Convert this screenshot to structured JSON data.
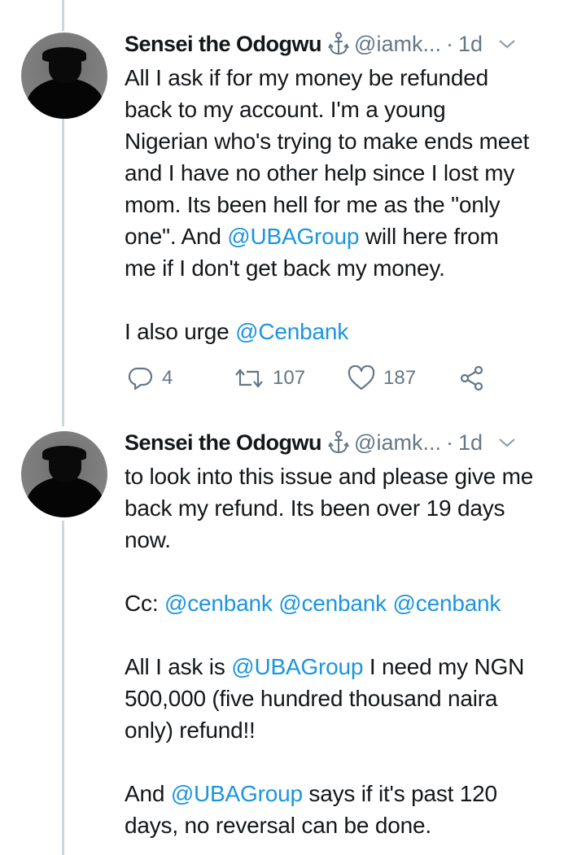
{
  "tweets": [
    {
      "author": "Sensei the Odogwu",
      "handle": "@iamk...",
      "separator": "·",
      "time": "1d",
      "lines": [
        [
          {
            "t": "All I ask if for my money be refunded"
          }
        ],
        [
          {
            "t": "back to my account. I'm a young"
          }
        ],
        [
          {
            "t": "Nigerian who's trying to make ends meet"
          }
        ],
        [
          {
            "t": "and I have no other help since I lost my"
          }
        ],
        [
          {
            "t": "mom. Its been hell for me as the \"only"
          }
        ],
        [
          {
            "t": "one\". And  "
          },
          {
            "t": "@UBAGroup",
            "m": true
          },
          {
            "t": " will here from"
          }
        ],
        [
          {
            "t": "me if I don't get back my money."
          }
        ],
        [],
        [
          {
            "t": "I also urge "
          },
          {
            "t": "@Cenbank",
            "m": true
          }
        ]
      ],
      "stats": {
        "replies": "4",
        "retweets": "107",
        "likes": "187"
      }
    },
    {
      "author": "Sensei the Odogwu",
      "handle": "@iamk...",
      "separator": "·",
      "time": "1d",
      "lines": [
        [
          {
            "t": "to look into this issue and please give me"
          }
        ],
        [
          {
            "t": "back my refund. Its been over 19 days"
          }
        ],
        [
          {
            "t": "now."
          }
        ],
        [],
        [
          {
            "t": "Cc: "
          },
          {
            "t": "@cenbank",
            "m": true
          },
          {
            "t": " "
          },
          {
            "t": "@cenbank",
            "m": true
          },
          {
            "t": " "
          },
          {
            "t": "@cenbank",
            "m": true
          }
        ],
        [],
        [
          {
            "t": "All I ask is "
          },
          {
            "t": "@UBAGroup",
            "m": true
          },
          {
            "t": " I need my NGN"
          }
        ],
        [
          {
            "t": "500,000 (five hundred thousand naira"
          }
        ],
        [
          {
            "t": "only) refund!!"
          }
        ],
        [],
        [
          {
            "t": "And  "
          },
          {
            "t": "@UBAGroup",
            "m": true
          },
          {
            "t": " says if it's past 120"
          }
        ],
        [
          {
            "t": "days, no reversal can be done."
          }
        ]
      ]
    }
  ],
  "icons": {
    "anchor": "anchor-icon",
    "chevron": "chevron-down-icon",
    "reply": "reply-icon",
    "retweet": "retweet-icon",
    "like": "heart-icon",
    "share": "share-icon"
  },
  "colors": {
    "mention": "#1b95e0",
    "secondary": "#657786",
    "thread_line": "#ccd6dd"
  }
}
